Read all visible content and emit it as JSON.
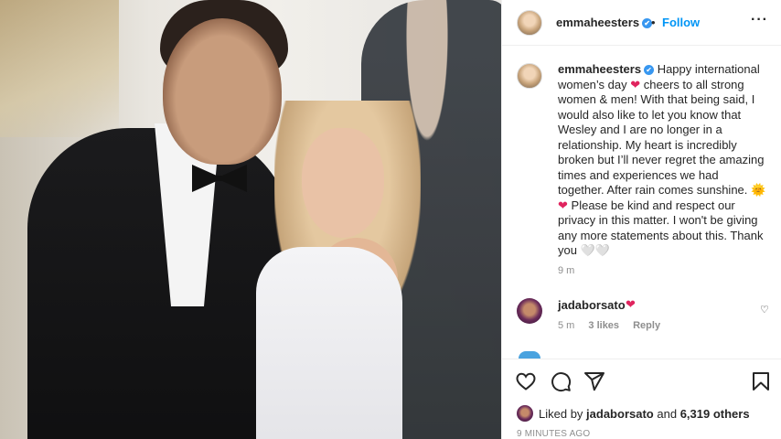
{
  "header": {
    "username": "emmaheesters",
    "verified_mark": "✔",
    "separator": "•",
    "follow_label": "Follow",
    "more_icon": "···"
  },
  "caption": {
    "username": "emmaheesters",
    "verified_mark": "✔",
    "part1": "Happy international women’s day",
    "heart1": "❤",
    "part2": "cheers to all strong women & men! With that being said, I would also like to let you know that Wesley and I are no longer in a relationship. My heart is incredibly broken but I’ll never regret the amazing times and experiences we had together. After rain comes sunshine.",
    "sun": "🌞",
    "heart2": "❤",
    "part3": "Please be kind and respect our privacy in this matter. I won't be giving any more statements about this. Thank you",
    "trailing": "🤍🤍",
    "time": "9 m"
  },
  "comment": {
    "username": "jadaborsato",
    "heart": "❤",
    "time": "5 m",
    "likes": "3 likes",
    "reply": "Reply",
    "like_icon": "♡"
  },
  "actions": {
    "like_icon": "heart-outline-icon",
    "comment_icon": "comment-icon",
    "share_icon": "share-icon",
    "save_icon": "bookmark-icon"
  },
  "likes": {
    "prefix": "Liked by",
    "user": "jadaborsato",
    "and": "and",
    "others": "6,319 others"
  },
  "post_time": "9 MINUTES AGO",
  "colors": {
    "accent": "#0095f6",
    "verified": "#3897f0",
    "heart": "#e0245e",
    "muted": "#8e8e8e"
  }
}
